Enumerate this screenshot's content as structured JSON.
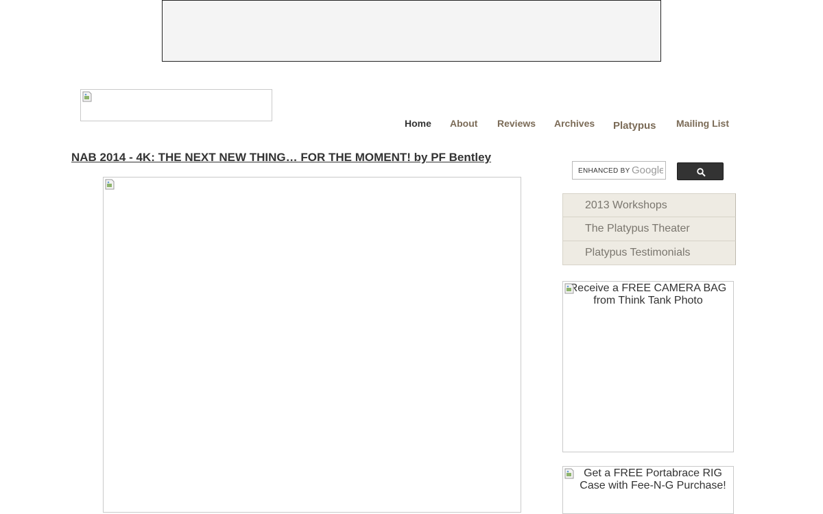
{
  "nav": {
    "items": [
      {
        "label": "Home"
      },
      {
        "label": "About"
      },
      {
        "label": "Reviews"
      },
      {
        "label": "Archives"
      },
      {
        "label": "Platypus"
      },
      {
        "label": "Mailing List"
      }
    ]
  },
  "post": {
    "title": "NAB 2014 - 4K: THE NEXT NEW THING… FOR THE MOMENT! by PF Bentley"
  },
  "search": {
    "label": "ENHANCED BY",
    "brand": "Google"
  },
  "sidebar": {
    "menu": [
      {
        "label": "2013 Workshops"
      },
      {
        "label": "The Platypus Theater"
      },
      {
        "label": "Platypus Testimonials"
      }
    ],
    "promos": [
      {
        "alt": "Receive a FREE CAMERA BAG from Think Tank Photo"
      },
      {
        "alt": "Get a FREE Portabrace RIG Case with Fee-N-G Purchase!"
      }
    ]
  }
}
